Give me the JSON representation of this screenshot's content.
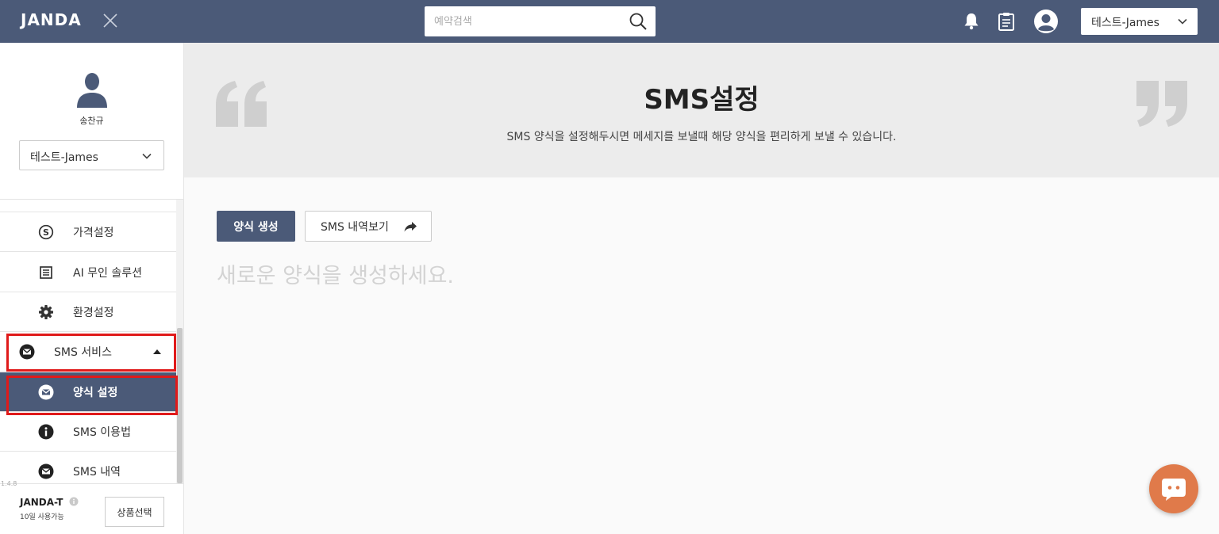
{
  "app": {
    "logo": "JANDA"
  },
  "search": {
    "placeholder": "예약검색"
  },
  "header": {
    "store_select": "테스트-James"
  },
  "profile": {
    "name": "송찬규",
    "store_select": "테스트-James"
  },
  "sidebar": {
    "items": [
      {
        "label": "가격설정",
        "icon": "dollar-icon"
      },
      {
        "label": "AI 무인 솔루션",
        "icon": "list-icon"
      },
      {
        "label": "환경설정",
        "icon": "gear-icon"
      },
      {
        "label": "SMS 서비스",
        "icon": "mail-icon",
        "expanded": true
      },
      {
        "label": "양식 설정",
        "icon": "mail-icon",
        "active": true
      },
      {
        "label": "SMS 이용법",
        "icon": "info-icon"
      },
      {
        "label": "SMS 내역",
        "icon": "mail-icon"
      }
    ],
    "footer": {
      "plan_name": "JANDA-T",
      "plan_days": "10일 사용가능",
      "plan_button": "상품선택",
      "version": "1.4.8"
    }
  },
  "hero": {
    "title": "SMS설정",
    "subtitle": "SMS 양식을 설정해두시면 메세지를 보낼때 해당 양식을 편리하게 보낼 수 있습니다."
  },
  "actions": {
    "create_label": "양식 생성",
    "history_label": "SMS 내역보기"
  },
  "empty_message": "새로운 양식을 생성하세요.",
  "colors": {
    "primary": "#4b5a78",
    "highlight": "#e01a1a",
    "chat": "#e07a4a"
  }
}
